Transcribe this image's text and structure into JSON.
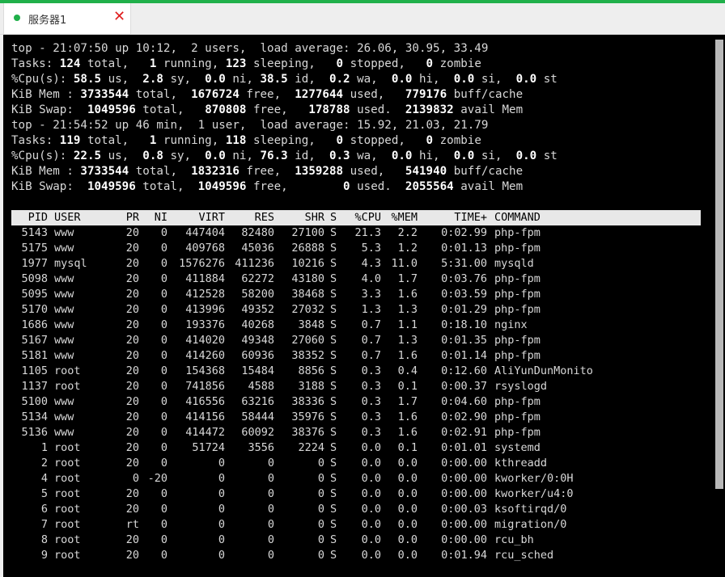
{
  "tab": {
    "title": "服务器1",
    "close_glyph": "✕"
  },
  "summary": [
    [
      [
        "top - 21:07:50 up 10:12,  2 users,  load average: 26.06, 30.95, 33.49",
        ""
      ]
    ],
    [
      [
        "Tasks: ",
        ""
      ],
      [
        "124",
        "b"
      ],
      [
        " total,   ",
        ""
      ],
      [
        "1",
        "b"
      ],
      [
        " running, ",
        ""
      ],
      [
        "123",
        "b"
      ],
      [
        " sleeping,   ",
        ""
      ],
      [
        "0",
        "b"
      ],
      [
        " stopped,   ",
        ""
      ],
      [
        "0",
        "b"
      ],
      [
        " zombie",
        ""
      ]
    ],
    [
      [
        "%Cpu(s): ",
        ""
      ],
      [
        "58.5",
        "b"
      ],
      [
        " us,  ",
        ""
      ],
      [
        "2.8",
        "b"
      ],
      [
        " sy,  ",
        ""
      ],
      [
        "0.0",
        "b"
      ],
      [
        " ni, ",
        ""
      ],
      [
        "38.5",
        "b"
      ],
      [
        " id,  ",
        ""
      ],
      [
        "0.2",
        "b"
      ],
      [
        " wa,  ",
        ""
      ],
      [
        "0.0",
        "b"
      ],
      [
        " hi,  ",
        ""
      ],
      [
        "0.0",
        "b"
      ],
      [
        " si,  ",
        ""
      ],
      [
        "0.0",
        "b"
      ],
      [
        " st",
        ""
      ]
    ],
    [
      [
        "KiB Mem : ",
        ""
      ],
      [
        "3733544",
        "b"
      ],
      [
        " total,  ",
        ""
      ],
      [
        "1676724",
        "b"
      ],
      [
        " free,  ",
        ""
      ],
      [
        "1277644",
        "b"
      ],
      [
        " used,   ",
        ""
      ],
      [
        "779176",
        "b"
      ],
      [
        " buff/cache",
        ""
      ]
    ],
    [
      [
        "KiB Swap:  ",
        ""
      ],
      [
        "1049596",
        "b"
      ],
      [
        " total,   ",
        ""
      ],
      [
        "870808",
        "b"
      ],
      [
        " free,   ",
        ""
      ],
      [
        "178788",
        "b"
      ],
      [
        " used.  ",
        ""
      ],
      [
        "2139832",
        "b"
      ],
      [
        " avail Mem",
        ""
      ]
    ],
    [
      [
        "top - 21:54:52 up 46 min,  1 user,  load average: 15.92, 21.03, 21.79",
        ""
      ]
    ],
    [
      [
        "Tasks: ",
        ""
      ],
      [
        "119",
        "b"
      ],
      [
        " total,   ",
        ""
      ],
      [
        "1",
        "b"
      ],
      [
        " running, ",
        ""
      ],
      [
        "118",
        "b"
      ],
      [
        " sleeping,   ",
        ""
      ],
      [
        "0",
        "b"
      ],
      [
        " stopped,   ",
        ""
      ],
      [
        "0",
        "b"
      ],
      [
        " zombie",
        ""
      ]
    ],
    [
      [
        "%Cpu(s): ",
        ""
      ],
      [
        "22.5",
        "b"
      ],
      [
        " us,  ",
        ""
      ],
      [
        "0.8",
        "b"
      ],
      [
        " sy,  ",
        ""
      ],
      [
        "0.0",
        "b"
      ],
      [
        " ni, ",
        ""
      ],
      [
        "76.3",
        "b"
      ],
      [
        " id,  ",
        ""
      ],
      [
        "0.3",
        "b"
      ],
      [
        " wa,  ",
        ""
      ],
      [
        "0.0",
        "b"
      ],
      [
        " hi,  ",
        ""
      ],
      [
        "0.0",
        "b"
      ],
      [
        " si,  ",
        ""
      ],
      [
        "0.0",
        "b"
      ],
      [
        " st",
        ""
      ]
    ],
    [
      [
        "KiB Mem : ",
        ""
      ],
      [
        "3733544",
        "b"
      ],
      [
        " total,  ",
        ""
      ],
      [
        "1832316",
        "b"
      ],
      [
        " free,  ",
        ""
      ],
      [
        "1359288",
        "b"
      ],
      [
        " used,   ",
        ""
      ],
      [
        "541940",
        "b"
      ],
      [
        " buff/cache",
        ""
      ]
    ],
    [
      [
        "KiB Swap:  ",
        ""
      ],
      [
        "1049596",
        "b"
      ],
      [
        " total,  ",
        ""
      ],
      [
        "1049596",
        "b"
      ],
      [
        " free,        ",
        ""
      ],
      [
        "0",
        "b"
      ],
      [
        " used.  ",
        ""
      ],
      [
        "2055564",
        "b"
      ],
      [
        " avail Mem",
        ""
      ]
    ]
  ],
  "columns": [
    "PID",
    "USER",
    "PR",
    "NI",
    "VIRT",
    "RES",
    "SHR",
    "S",
    "%CPU",
    "%MEM",
    "TIME+",
    "COMMAND"
  ],
  "processes": [
    [
      "5143",
      "www",
      "20",
      "0",
      "447404",
      "82480",
      "27100",
      "S",
      "21.3",
      "2.2",
      "0:02.99",
      "php-fpm"
    ],
    [
      "5175",
      "www",
      "20",
      "0",
      "409768",
      "45036",
      "26888",
      "S",
      "5.3",
      "1.2",
      "0:01.13",
      "php-fpm"
    ],
    [
      "1977",
      "mysql",
      "20",
      "0",
      "1576276",
      "411236",
      "10216",
      "S",
      "4.3",
      "11.0",
      "5:31.00",
      "mysqld"
    ],
    [
      "5098",
      "www",
      "20",
      "0",
      "411884",
      "62272",
      "43180",
      "S",
      "4.0",
      "1.7",
      "0:03.76",
      "php-fpm"
    ],
    [
      "5095",
      "www",
      "20",
      "0",
      "412528",
      "58200",
      "38468",
      "S",
      "3.3",
      "1.6",
      "0:03.59",
      "php-fpm"
    ],
    [
      "5170",
      "www",
      "20",
      "0",
      "413996",
      "49352",
      "27032",
      "S",
      "1.3",
      "1.3",
      "0:01.29",
      "php-fpm"
    ],
    [
      "1686",
      "www",
      "20",
      "0",
      "193376",
      "40268",
      "3848",
      "S",
      "0.7",
      "1.1",
      "0:18.10",
      "nginx"
    ],
    [
      "5167",
      "www",
      "20",
      "0",
      "414020",
      "49348",
      "27060",
      "S",
      "0.7",
      "1.3",
      "0:01.35",
      "php-fpm"
    ],
    [
      "5181",
      "www",
      "20",
      "0",
      "414260",
      "60936",
      "38352",
      "S",
      "0.7",
      "1.6",
      "0:01.14",
      "php-fpm"
    ],
    [
      "1105",
      "root",
      "20",
      "0",
      "154368",
      "15484",
      "8856",
      "S",
      "0.3",
      "0.4",
      "0:12.60",
      "AliYunDunMonito"
    ],
    [
      "1137",
      "root",
      "20",
      "0",
      "741856",
      "4588",
      "3188",
      "S",
      "0.3",
      "0.1",
      "0:00.37",
      "rsyslogd"
    ],
    [
      "5100",
      "www",
      "20",
      "0",
      "416556",
      "63216",
      "38336",
      "S",
      "0.3",
      "1.7",
      "0:04.60",
      "php-fpm"
    ],
    [
      "5134",
      "www",
      "20",
      "0",
      "414156",
      "58444",
      "35976",
      "S",
      "0.3",
      "1.6",
      "0:02.90",
      "php-fpm"
    ],
    [
      "5136",
      "www",
      "20",
      "0",
      "414472",
      "60092",
      "38376",
      "S",
      "0.3",
      "1.6",
      "0:02.91",
      "php-fpm"
    ],
    [
      "1",
      "root",
      "20",
      "0",
      "51724",
      "3556",
      "2224",
      "S",
      "0.0",
      "0.1",
      "0:01.01",
      "systemd"
    ],
    [
      "2",
      "root",
      "20",
      "0",
      "0",
      "0",
      "0",
      "S",
      "0.0",
      "0.0",
      "0:00.00",
      "kthreadd"
    ],
    [
      "4",
      "root",
      "0",
      "-20",
      "0",
      "0",
      "0",
      "S",
      "0.0",
      "0.0",
      "0:00.00",
      "kworker/0:0H"
    ],
    [
      "5",
      "root",
      "20",
      "0",
      "0",
      "0",
      "0",
      "S",
      "0.0",
      "0.0",
      "0:00.00",
      "kworker/u4:0"
    ],
    [
      "6",
      "root",
      "20",
      "0",
      "0",
      "0",
      "0",
      "S",
      "0.0",
      "0.0",
      "0:00.03",
      "ksoftirqd/0"
    ],
    [
      "7",
      "root",
      "rt",
      "0",
      "0",
      "0",
      "0",
      "S",
      "0.0",
      "0.0",
      "0:00.00",
      "migration/0"
    ],
    [
      "8",
      "root",
      "20",
      "0",
      "0",
      "0",
      "0",
      "S",
      "0.0",
      "0.0",
      "0:00.00",
      "rcu_bh"
    ],
    [
      "9",
      "root",
      "20",
      "0",
      "0",
      "0",
      "0",
      "S",
      "0.0",
      "0.0",
      "0:01.94",
      "rcu_sched"
    ]
  ],
  "colors": {
    "accent": "#20b04a",
    "close": "#e02020",
    "terminal_bg": "#000000",
    "header_bg": "#e8e8e8"
  }
}
